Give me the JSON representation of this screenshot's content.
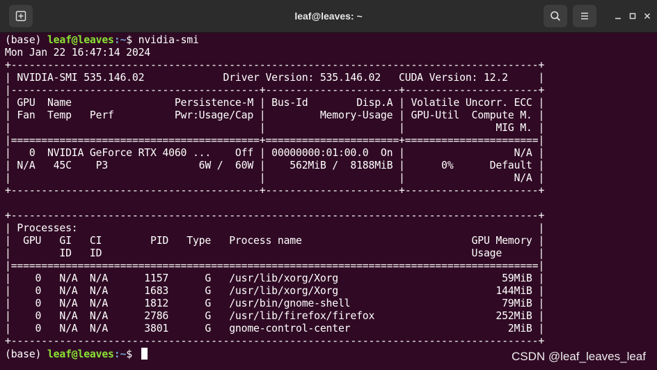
{
  "window": {
    "title": "leaf@leaves: ~",
    "icons": [
      "new-tab-icon",
      "search-icon",
      "menu-icon",
      "minimize-icon",
      "maximize-icon",
      "close-icon"
    ]
  },
  "prompt": {
    "env": "(base) ",
    "user_host": "leaf@leaves",
    "path": ":~",
    "symbol": "$ "
  },
  "command": "nvidia-smi",
  "output": [
    "Mon Jan 22 16:47:14 2024",
    "+---------------------------------------------------------------------------------------+",
    "| NVIDIA-SMI 535.146.02             Driver Version: 535.146.02   CUDA Version: 12.2     |",
    "|-----------------------------------------+----------------------+----------------------+",
    "| GPU  Name                 Persistence-M | Bus-Id        Disp.A | Volatile Uncorr. ECC |",
    "| Fan  Temp   Perf          Pwr:Usage/Cap |         Memory-Usage | GPU-Util  Compute M. |",
    "|                                         |                      |               MIG M. |",
    "|=========================================+======================+======================|",
    "|   0  NVIDIA GeForce RTX 4060 ...    Off | 00000000:01:00.0  On |                  N/A |",
    "| N/A   45C    P3               6W /  60W |    562MiB /  8188MiB |      0%      Default |",
    "|                                         |                      |                  N/A |",
    "+-----------------------------------------+----------------------+----------------------+",
    "",
    "+---------------------------------------------------------------------------------------+",
    "| Processes:                                                                            |",
    "|  GPU   GI   CI        PID   Type   Process name                            GPU Memory |",
    "|        ID   ID                                                             Usage      |",
    "|=======================================================================================|",
    "|    0   N/A  N/A      1157      G   /usr/lib/xorg/Xorg                           59MiB |",
    "|    0   N/A  N/A      1683      G   /usr/lib/xorg/Xorg                          144MiB |",
    "|    0   N/A  N/A      1812      G   /usr/bin/gnome-shell                         79MiB |",
    "|    0   N/A  N/A      2786      G   /usr/lib/firefox/firefox                    252MiB |",
    "|    0   N/A  N/A      3801      G   gnome-control-center                          2MiB |",
    "+---------------------------------------------------------------------------------------+"
  ],
  "watermark": "CSDN @leaf_leaves_leaf",
  "colors": {
    "background": "#300a24",
    "titlebar": "#2c2c2c",
    "prompt_user": "#8ae234",
    "prompt_path": "#729fcf",
    "text": "#ffffff"
  }
}
